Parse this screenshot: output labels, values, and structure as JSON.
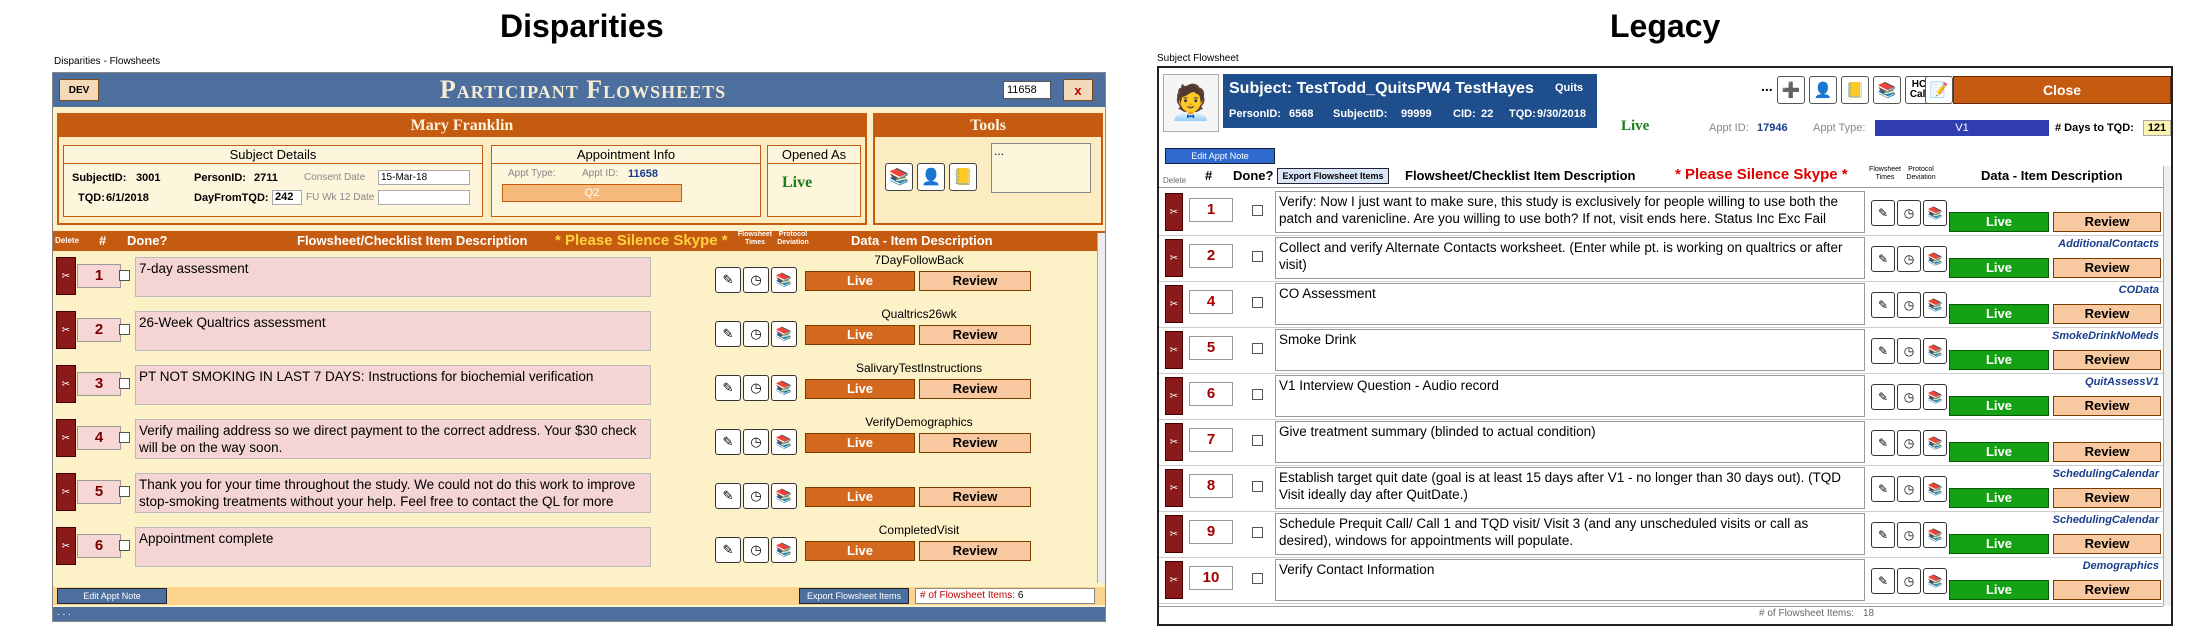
{
  "headings": {
    "left": "Disparities",
    "right": "Legacy"
  },
  "left": {
    "window_title": "Disparities - Flowsheets",
    "dev_label": "DEV",
    "app_title": "Participant Flowsheets",
    "id_value": "11658",
    "close_x": "x",
    "participant_name": "Mary Franklin",
    "tools_title": "Tools",
    "tools_ellipsis": "...",
    "subject_details": {
      "title": "Subject Details",
      "subject_id_label": "SubjectID:",
      "subject_id": "3001",
      "person_id_label": "PersonID:",
      "person_id": "2711",
      "consent_label": "Consent Date",
      "consent_value": "15-Mar-18",
      "tqd_label": "TQD:",
      "tqd": "6/1/2018",
      "dayfrom_label": "DayFromTQD:",
      "dayfrom": "242",
      "fu_label": "FU Wk 12 Date",
      "fu_value": ""
    },
    "appointment_info": {
      "title": "Appointment Info",
      "appt_type_label": "Appt Type:",
      "appt_id_label": "Appt ID:",
      "appt_id": "11658",
      "appt_type_value": "Q2"
    },
    "opened_as": {
      "title": "Opened As",
      "value": "Live"
    },
    "columns": {
      "delete": "Delete",
      "num": "#",
      "done": "Done?",
      "desc": "Flowsheet/Checklist Item Description",
      "silence": "* Please Silence Skype *",
      "flowsheet_times": "Flowsheet Times",
      "protocol_deviation": "Protocol Deviation",
      "data_desc": "Data - Item Description"
    },
    "rows": [
      {
        "num": "1",
        "desc": "7-day assessment",
        "data": "7DayFollowBack",
        "live": "Live",
        "review": "Review"
      },
      {
        "num": "2",
        "desc": "26-Week Qualtrics assessment",
        "data": "Qualtrics26wk",
        "live": "Live",
        "review": "Review"
      },
      {
        "num": "3",
        "desc": "PT NOT SMOKING IN LAST 7 DAYS: Instructions for biochemial verification",
        "data": "SalivaryTestInstructions",
        "live": "Live",
        "review": "Review"
      },
      {
        "num": "4",
        "desc": "Verify mailing address so we direct payment to the correct address. Your $30 check will be on the way soon.",
        "data": "VerifyDemographics",
        "live": "Live",
        "review": "Review"
      },
      {
        "num": "5",
        "desc": "Thank you for your time throughout the study. We could not do this work to improve stop-smoking treatments without your help. Feel free to contact the QL for more",
        "data": "",
        "live": "Live",
        "review": "Review"
      },
      {
        "num": "6",
        "desc": "Appointment complete",
        "data": "CompletedVisit",
        "live": "Live",
        "review": "Review"
      }
    ],
    "edit_appt_note": "Edit Appt Note",
    "export_items": "Export Flowsheet Items",
    "count_label": "# of Flowsheet Items:",
    "count_value": "6",
    "status_text": ". . ."
  },
  "right": {
    "window_title": "Subject Flowsheet",
    "subject_title": "Subject: TestTodd_QuitsPW4 TestHayes",
    "quits": "Quits",
    "person_id_label": "PersonID:",
    "person_id": "6568",
    "subject_id_label": "SubjectID:",
    "subject_id": "99999",
    "cid_label": "CID:",
    "cid": "22",
    "tqd_label": "TQD:",
    "tqd": "9/30/2018",
    "live": "Live",
    "appt_id_label": "Appt ID:",
    "appt_id": "17946",
    "appt_type_label": "Appt Type:",
    "appt_type": "V1",
    "days_label": "# Days to TQD:",
    "days": "121",
    "ellipsis": "...",
    "hc_call": "HC Call",
    "close": "Close",
    "edit_appt_note": "Edit Appt Note",
    "columns": {
      "delete": "Delete",
      "num": "#",
      "done": "Done?",
      "export": "Export Flowsheet Items",
      "desc": "Flowsheet/Checklist Item Description",
      "silence": "* Please Silence Skype *",
      "flowsheet_times": "Flowsheet Times",
      "protocol_deviation": "Protocol Deviation",
      "data_desc": "Data - Item Description"
    },
    "rows": [
      {
        "num": "1",
        "desc": "Verify: Now I just want to make sure, this study is exclusively for people willing to use both the patch and varenicline. Are you willing to use both? If not, visit ends here. Status Inc Exc Fail",
        "data": "",
        "live": "Live",
        "review": "Review"
      },
      {
        "num": "2",
        "desc": "Collect and verify Alternate Contacts worksheet. (Enter while pt. is working on qualtrics or after visit)",
        "data": "AdditionalContacts",
        "live": "Live",
        "review": "Review"
      },
      {
        "num": "4",
        "desc": "CO Assessment",
        "data": "COData",
        "live": "Live",
        "review": "Review"
      },
      {
        "num": "5",
        "desc": "Smoke Drink",
        "data": "SmokeDrinkNoMeds",
        "live": "Live",
        "review": "Review"
      },
      {
        "num": "6",
        "desc": "V1 Interview Question - Audio record",
        "data": "QuitAssessV1",
        "live": "Live",
        "review": "Review"
      },
      {
        "num": "7",
        "desc": "Give treatment summary (blinded to actual condition)",
        "data": "",
        "live": "Live",
        "review": "Review"
      },
      {
        "num": "8",
        "desc": "Establish target quit date (goal is at least 15 days after V1 - no longer than 30 days out). (TQD Visit ideally day after QuitDate.)",
        "data": "SchedulingCalendar",
        "live": "Live",
        "review": "Review"
      },
      {
        "num": "9",
        "desc": "Schedule Prequit Call/ Call 1 and TQD visit/ Visit 3 (and any unscheduled visits or call as desired), windows for appointments will populate.",
        "data": "SchedulingCalendar",
        "live": "Live",
        "review": "Review"
      },
      {
        "num": "10",
        "desc": "Verify Contact Information",
        "data": "Demographics",
        "live": "Live",
        "review": "Review"
      }
    ],
    "count_label": "# of Flowsheet Items:",
    "count_value": "18"
  }
}
